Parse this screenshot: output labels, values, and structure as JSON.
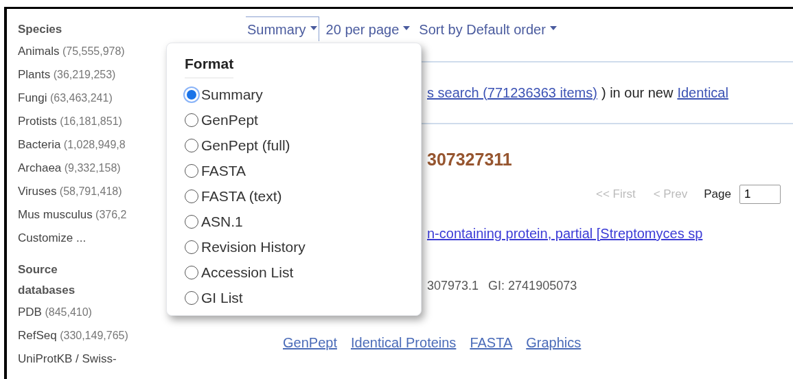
{
  "sidebar": [
    {
      "heading": "Species",
      "items": [
        {
          "name": "Animals",
          "count": "(75,555,978)"
        },
        {
          "name": "Plants",
          "count": "(36,219,253)"
        },
        {
          "name": "Fungi",
          "count": "(63,463,241)"
        },
        {
          "name": "Protists",
          "count": "(16,181,851)"
        },
        {
          "name": "Bacteria",
          "count": "(1,028,949,8"
        },
        {
          "name": "Archaea",
          "count": "(9,332,158)"
        },
        {
          "name": "Viruses",
          "count": "(58,791,418)"
        },
        {
          "name": "Mus musculus",
          "count": "(376,2"
        },
        {
          "name": "Customize ..."
        }
      ]
    },
    {
      "heading": "Source databases",
      "items": [
        {
          "name": "PDB",
          "count": "(845,410)"
        },
        {
          "name": "RefSeq",
          "count": "(330,149,765)"
        },
        {
          "name": "UniProtKB / Swiss-"
        }
      ]
    }
  ],
  "toolbar": [
    {
      "label": "Summary",
      "open": true
    },
    {
      "label": "20 per page",
      "open": false
    },
    {
      "label": "Sort by Default order",
      "open": false
    }
  ],
  "format_menu": {
    "title": "Format",
    "options": [
      {
        "label": "Summary",
        "selected": true
      },
      {
        "label": "GenPept",
        "selected": false
      },
      {
        "label": "GenPept (full)",
        "selected": false
      },
      {
        "label": "FASTA",
        "selected": false
      },
      {
        "label": "FASTA (text)",
        "selected": false
      },
      {
        "label": "ASN.1",
        "selected": false
      },
      {
        "label": "Revision History",
        "selected": false
      },
      {
        "label": "Accession List",
        "selected": false
      },
      {
        "label": "GI List",
        "selected": false
      }
    ]
  },
  "notice": [
    {
      "kind": "link",
      "text": "s search (771236363 items)"
    },
    {
      "kind": "text",
      "text": ") in our new"
    },
    {
      "kind": "link",
      "text": "Identical"
    }
  ],
  "result_count_title": "307327311",
  "pager": {
    "first": "<< First",
    "prev": "< Prev",
    "page_label": "Page",
    "page_value": "1"
  },
  "result": {
    "title_link": "n-containing protein, partial [Streptomyces sp",
    "accession": "307973.1",
    "gi": "GI: 2741905073",
    "links": [
      "GenPept",
      "Identical Proteins",
      "FASTA",
      "Graphics"
    ]
  }
}
